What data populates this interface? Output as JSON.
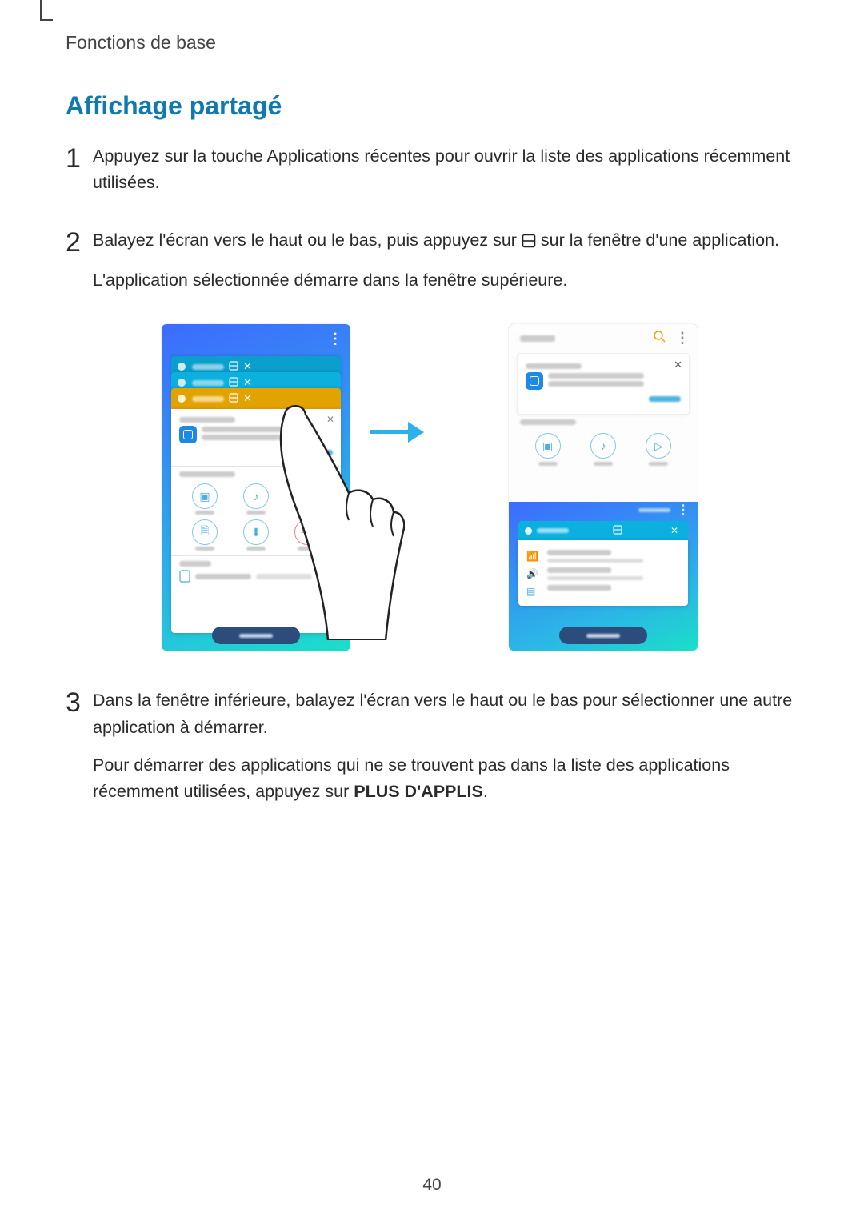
{
  "header": {
    "section": "Fonctions de base"
  },
  "title": "Affichage partagé",
  "steps": {
    "s1": {
      "num": "1",
      "text": "Appuyez sur la touche Applications récentes pour ouvrir la liste des applications récemment utilisées."
    },
    "s2": {
      "num": "2",
      "text_a": "Balayez l'écran vers le haut ou le bas, puis appuyez sur ",
      "text_b": " sur la fenêtre d'une application.",
      "text_c": "L'application sélectionnée démarre dans la fenêtre supérieure."
    },
    "s3": {
      "num": "3",
      "text_a": "Dans la fenêtre inférieure, balayez l'écran vers le haut ou le bas pour sélectionner une autre application à démarrer.",
      "text_b_pre": "Pour démarrer des applications qui ne se trouvent pas dans la liste des applications récemment utilisées, appuyez sur ",
      "text_b_bold": "PLUS D'APPLIS",
      "text_b_post": "."
    }
  },
  "page": "40"
}
